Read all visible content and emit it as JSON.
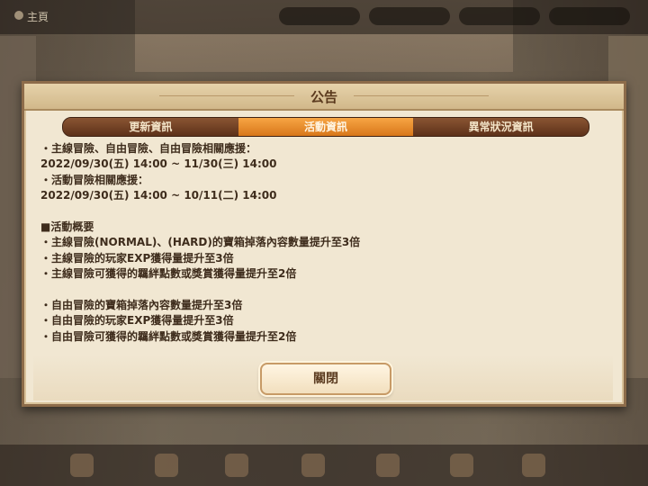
{
  "topbar": {
    "home_label": "主頁"
  },
  "dialog": {
    "title": "公告",
    "tabs": [
      {
        "label": "更新資訊",
        "active": false
      },
      {
        "label": "活動資訊",
        "active": true
      },
      {
        "label": "異常狀況資訊",
        "active": false
      }
    ],
    "lines": [
      "・主線冒險、自由冒險、自由冒險相關應援：",
      "2022/09/30(五) 14:00 ~ 11/30(三) 14:00",
      "・活動冒險相關應援：",
      "2022/09/30(五) 14:00 ~ 10/11(二) 14:00",
      "",
      "■活動概要",
      "・主線冒險(NORMAL)、(HARD)的寶箱掉落內容數量提升至3倍",
      "・主線冒險的玩家EXP獲得量提升至3倍",
      "・主線冒險可獲得的羈絆點數或獎賞獲得量提升至2倍",
      "",
      "・自由冒險的寶箱掉落內容數量提升至3倍",
      "・自由冒險的玩家EXP獲得量提升至3倍",
      "・自由冒險可獲得的羈絆點數或獎賞獲得量提升至2倍"
    ],
    "close_label": "關閉"
  },
  "colors": {
    "tab_active": "#e88b2c",
    "tab_inactive": "#6a3d24",
    "panel": "#f1e7d2",
    "text": "#3e2c1c"
  }
}
